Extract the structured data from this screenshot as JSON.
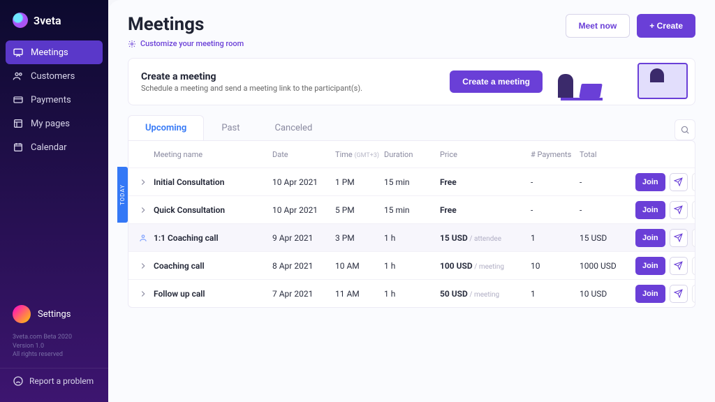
{
  "brand": {
    "name": "3veta"
  },
  "sidebar": {
    "items": [
      {
        "label": "Meetings",
        "icon": "chat-icon"
      },
      {
        "label": "Customers",
        "icon": "users-icon"
      },
      {
        "label": "Payments",
        "icon": "card-icon"
      },
      {
        "label": "My pages",
        "icon": "pages-icon"
      },
      {
        "label": "Calendar",
        "icon": "calendar-icon"
      }
    ],
    "settings_label": "Settings",
    "meta_lines": [
      "3veta.com Beta 2020",
      "Version 1.0",
      "All rights reserved"
    ],
    "report_label": "Report a problem"
  },
  "header": {
    "title": "Meetings",
    "meet_now": "Meet now",
    "create": "+ Create",
    "customize": "Customize your meeting room"
  },
  "banner": {
    "title": "Create a meeting",
    "subtitle": "Schedule a meeting and send a meeting link to the participant(s).",
    "cta": "Create a meeting"
  },
  "tabs": {
    "upcoming": "Upcoming",
    "past": "Past",
    "canceled": "Canceled"
  },
  "table": {
    "today_flag": "TODAY",
    "headers": {
      "name": "Meeting name",
      "date": "Date",
      "time": "Time",
      "time_tz": "(GMT+3)",
      "duration": "Duration",
      "price": "Price",
      "payments": "# Payments",
      "total": "Total"
    },
    "join_label": "Join",
    "rows": [
      {
        "name": "Initial Consultation",
        "date": "10 Apr 2021",
        "time": "1 PM",
        "duration": "15 min",
        "price": "Free",
        "price_extra": "",
        "payments": "-",
        "total": "-",
        "icon": "chevron"
      },
      {
        "name": "Quick Consultation",
        "date": "10 Apr 2021",
        "time": "5 PM",
        "duration": "15 min",
        "price": "Free",
        "price_extra": "",
        "payments": "-",
        "total": "-",
        "icon": "chevron"
      },
      {
        "name": "1:1 Coaching call",
        "date": "9 Apr 2021",
        "time": "3 PM",
        "duration": "1 h",
        "price": "15 USD",
        "price_extra": " / attendee",
        "payments": "1",
        "total": "15   USD",
        "icon": "person"
      },
      {
        "name": "Coaching call",
        "date": "8 Apr 2021",
        "time": "10 AM",
        "duration": "1 h",
        "price": "100 USD",
        "price_extra": " / meeting",
        "payments": "10",
        "total": "1000   USD",
        "icon": "chevron"
      },
      {
        "name": "Follow up call",
        "date": "7 Apr 2021",
        "time": "11 AM",
        "duration": "1 h",
        "price": "50 USD",
        "price_extra": " / meeting",
        "payments": "1",
        "total": "10   USD",
        "icon": "chevron"
      }
    ]
  }
}
